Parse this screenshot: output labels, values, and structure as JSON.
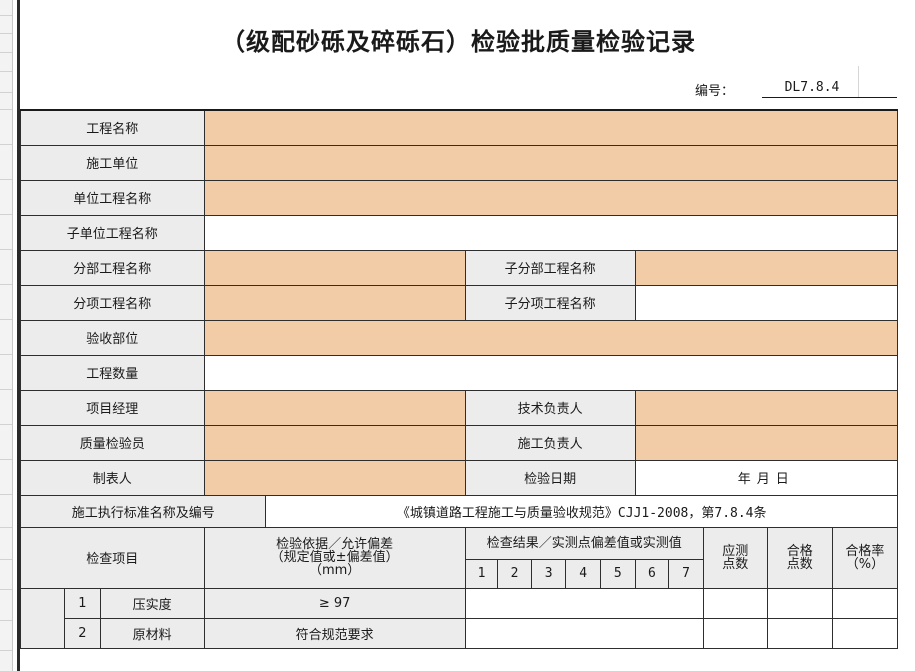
{
  "title": "（级配砂砾及碎砾石）检验批质量检验记录",
  "code": {
    "label": "编号：",
    "value": "DL7.8.4"
  },
  "fields": {
    "project_name": "工程名称",
    "construction_unit": "施工单位",
    "unit_project_name": "单位工程名称",
    "sub_unit_project_name": "子单位工程名称",
    "division_project_name": "分部工程名称",
    "sub_division_project_name": "子分部工程名称",
    "item_project_name": "分项工程名称",
    "sub_item_project_name": "子分项工程名称",
    "acceptance_part": "验收部位",
    "quantity": "工程数量",
    "project_manager": "项目经理",
    "technical_lead": "技术负责人",
    "quality_inspector": "质量检验员",
    "construction_lead": "施工负责人",
    "tabulator": "制表人",
    "inspection_date": "检验日期",
    "date_value": "年月日"
  },
  "standard": {
    "label": "施工执行标准名称及编号",
    "value": "《城镇道路工程施工与质量验收规范》CJJ1-2008，第7.8.4条"
  },
  "inspection_header": {
    "item": "检查项目",
    "basis_line1": "检验依据／允许偏差",
    "basis_line2": "（规定值或±偏差值）",
    "basis_line3": "（mm）",
    "results": "检查结果／实测点偏差值或实测值",
    "point_numbers": [
      "1",
      "2",
      "3",
      "4",
      "5",
      "6",
      "7"
    ],
    "required_points": "应测点数",
    "qualified_points": "合格点数",
    "pass_rate_line1": "合格率",
    "pass_rate_line2": "（%）"
  },
  "items": [
    {
      "no": "1",
      "name": "压实度",
      "basis": "≥ 97"
    },
    {
      "no": "2",
      "name": "原材料",
      "basis": "符合规范要求"
    }
  ],
  "colors": {
    "fill": "#f2cba7",
    "label_bg": "#ececec",
    "border": "#2e2e2e"
  }
}
